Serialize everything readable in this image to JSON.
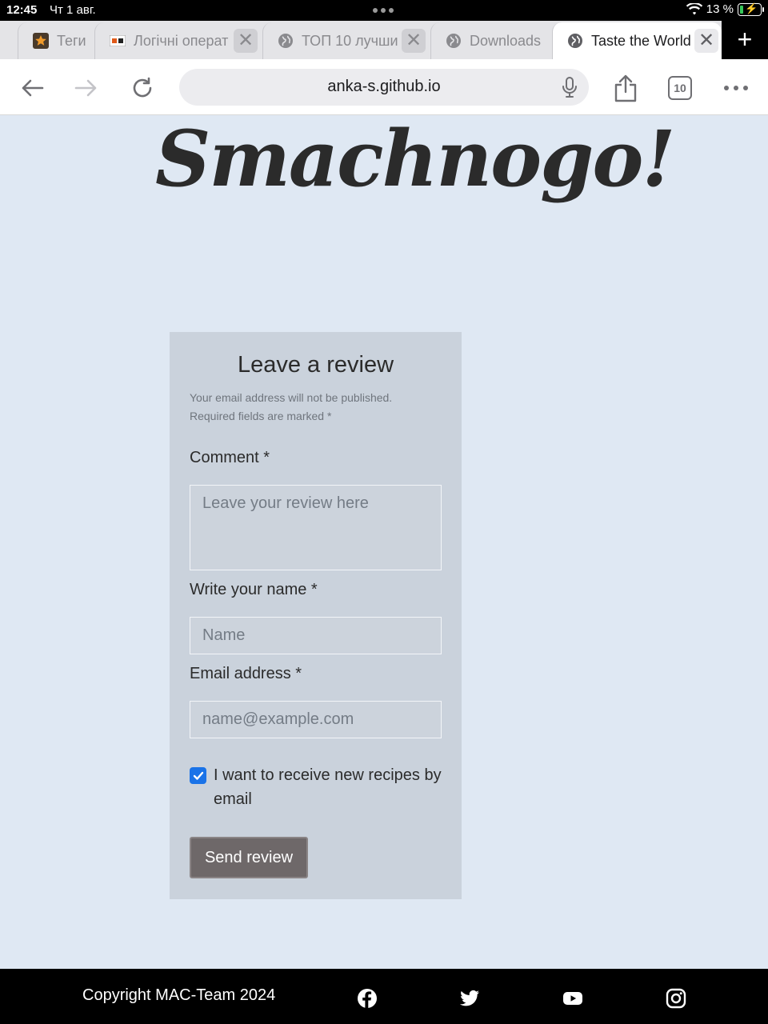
{
  "status_bar": {
    "time": "12:45",
    "date": "Чт 1 авг.",
    "battery": "13 %"
  },
  "tabs": [
    {
      "title": "Теги",
      "icon": "star-icon"
    },
    {
      "title": "Логічні операт",
      "icon": "site-logo-icon"
    },
    {
      "title": "ТОП 10 лучши",
      "icon": "globe-icon"
    },
    {
      "title": "Downloads",
      "icon": "globe-icon"
    },
    {
      "title": "Taste the World",
      "icon": "globe-icon"
    }
  ],
  "toolbar": {
    "url": "anka-s.github.io",
    "tab_count": "10"
  },
  "page": {
    "brand": "Smachnogo!",
    "review": {
      "heading": "Leave a review",
      "note_line1": "Your email address will not be published.",
      "note_line2": "Required fields are marked *",
      "comment_label": "Comment *",
      "comment_placeholder": "Leave your review here",
      "name_label": "Write your name *",
      "name_placeholder": "Name",
      "email_label": "Email address *",
      "email_placeholder": "name@example.com",
      "checkbox_label": "I want to receive new recipes by email",
      "checkbox_checked": true,
      "submit_label": "Send review"
    }
  },
  "footer": {
    "copyright": "Copyright MAC-Team 2024",
    "social_icons": [
      "facebook-icon",
      "twitter-icon",
      "youtube-icon",
      "instagram-icon"
    ]
  },
  "colors": {
    "page_bg": "#dfe8f3",
    "form_bg": "#cad2dc",
    "button_bg": "#6e6869",
    "checkbox": "#1a73e8",
    "footer_bg": "#000000"
  }
}
